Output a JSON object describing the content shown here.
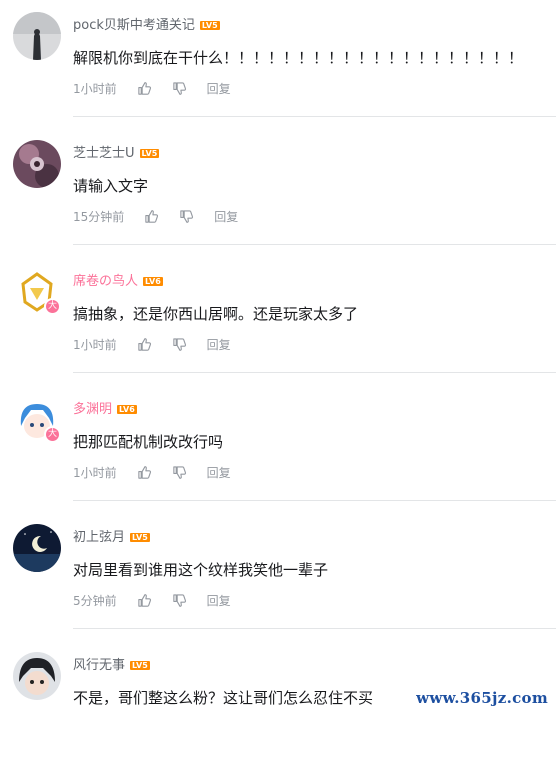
{
  "comments": [
    {
      "username": "pock贝斯中考通关记",
      "level": "LV5",
      "text": "解限机你到底在干什么！！！！！！！！！！！！！！！！！！！！",
      "time": "1小时前",
      "reply_label": "回复"
    },
    {
      "username": "芝士芝士U",
      "level": "LV5",
      "text": "请输入文字",
      "time": "15分钟前",
      "reply_label": "回复"
    },
    {
      "username": "席卷の鸟人",
      "level": "LV6",
      "text": "搞抽象，还是你西山居啊。还是玩家太多了",
      "time": "1小时前",
      "reply_label": "回复",
      "vip_badge": "大"
    },
    {
      "username": "多渊明",
      "level": "LV6",
      "text": "把那匹配机制改改行吗",
      "time": "1小时前",
      "reply_label": "回复",
      "vip_badge": "大"
    },
    {
      "username": "初上弦月",
      "level": "LV5",
      "text": "对局里看到谁用这个纹样我笑他一辈子",
      "time": "5分钟前",
      "reply_label": "回复"
    },
    {
      "username": "风行无事",
      "level": "LV5",
      "text": "不是，哥们整这么粉？这让哥们怎么忍住不买",
      "time": "",
      "reply_label": ""
    }
  ],
  "watermark": "www.365jz.com",
  "icons": {
    "like": "thumb-up-icon",
    "dislike": "thumb-down-icon"
  },
  "colors": {
    "vip_name": "#fb7299",
    "name": "#61666d",
    "level_badge": "#ff8c00",
    "meta": "#9499a0"
  }
}
